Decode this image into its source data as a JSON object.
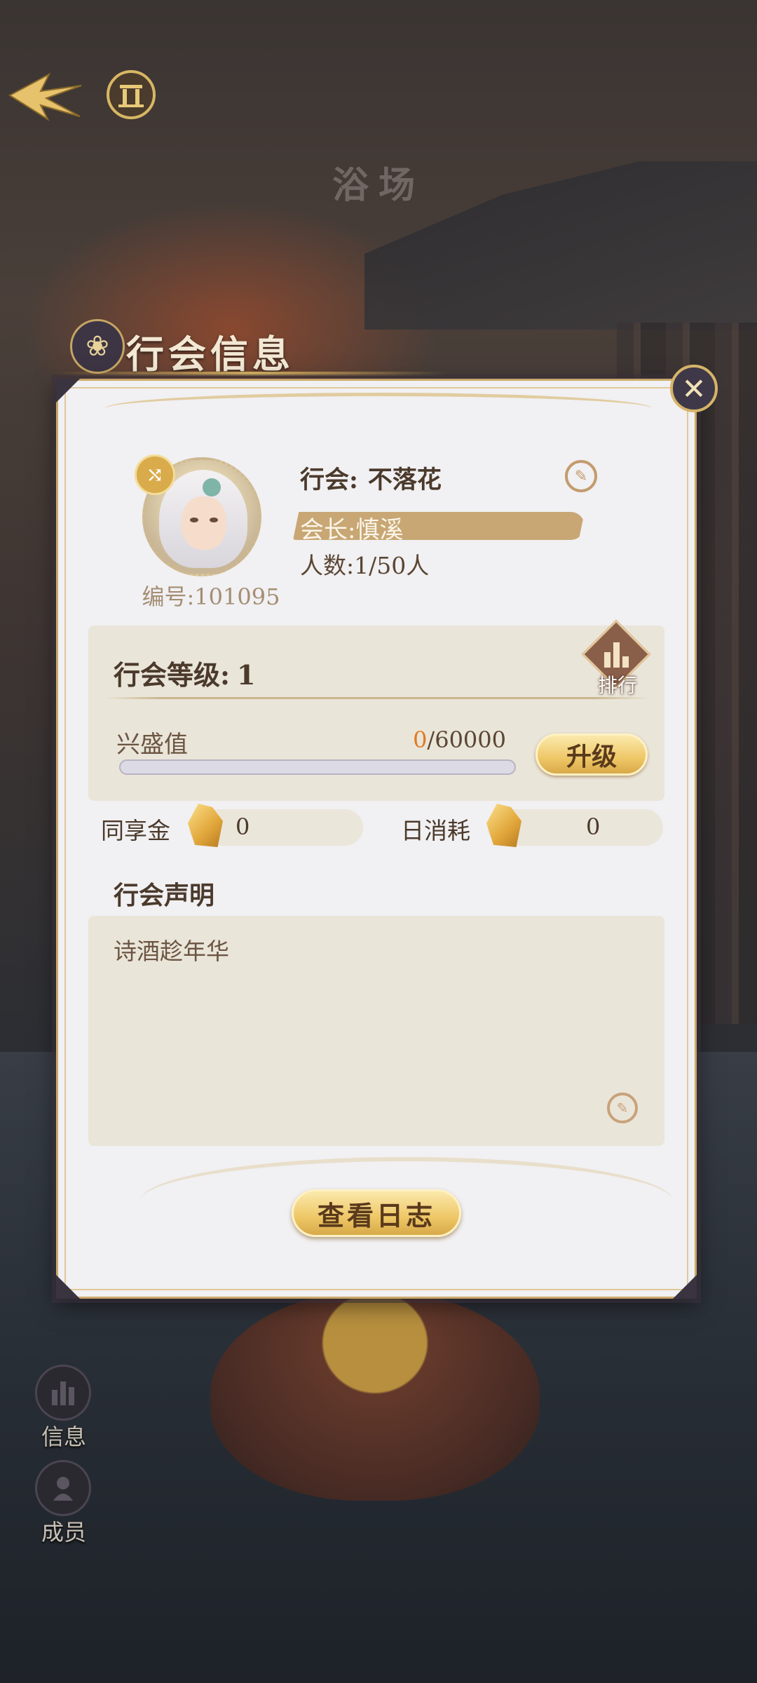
{
  "header": {
    "scene_title": "浴场",
    "panel_title": "行会信息"
  },
  "guild": {
    "id_label": "编号:101095",
    "name_label": "行会:",
    "name_value": "不落花",
    "leader_label": "会长:",
    "leader_value": "慎溪",
    "count_label": "人数:",
    "count_value": "1/50人"
  },
  "level": {
    "title_label": "行会等级:",
    "value": "1",
    "rank_label": "排行",
    "prosperity_label": "兴盛值",
    "prosperity_current": "0",
    "prosperity_max": "/60000",
    "prosperity_progress": 0,
    "upgrade_label": "升级"
  },
  "currency": {
    "shared_label": "同享金",
    "shared_value": "0",
    "daily_label": "日消耗",
    "daily_value": "0"
  },
  "declaration": {
    "title": "行会声明",
    "text": "诗酒趁年华"
  },
  "buttons": {
    "view_log": "查看日志"
  },
  "side_nav": [
    {
      "label": "信息",
      "icon": "buildings-icon"
    },
    {
      "label": "成员",
      "icon": "member-icon"
    }
  ],
  "colors": {
    "accent_gold": "#d8a949",
    "panel_bg": "#f1f0f2",
    "highlight_orange": "#e07a22"
  }
}
